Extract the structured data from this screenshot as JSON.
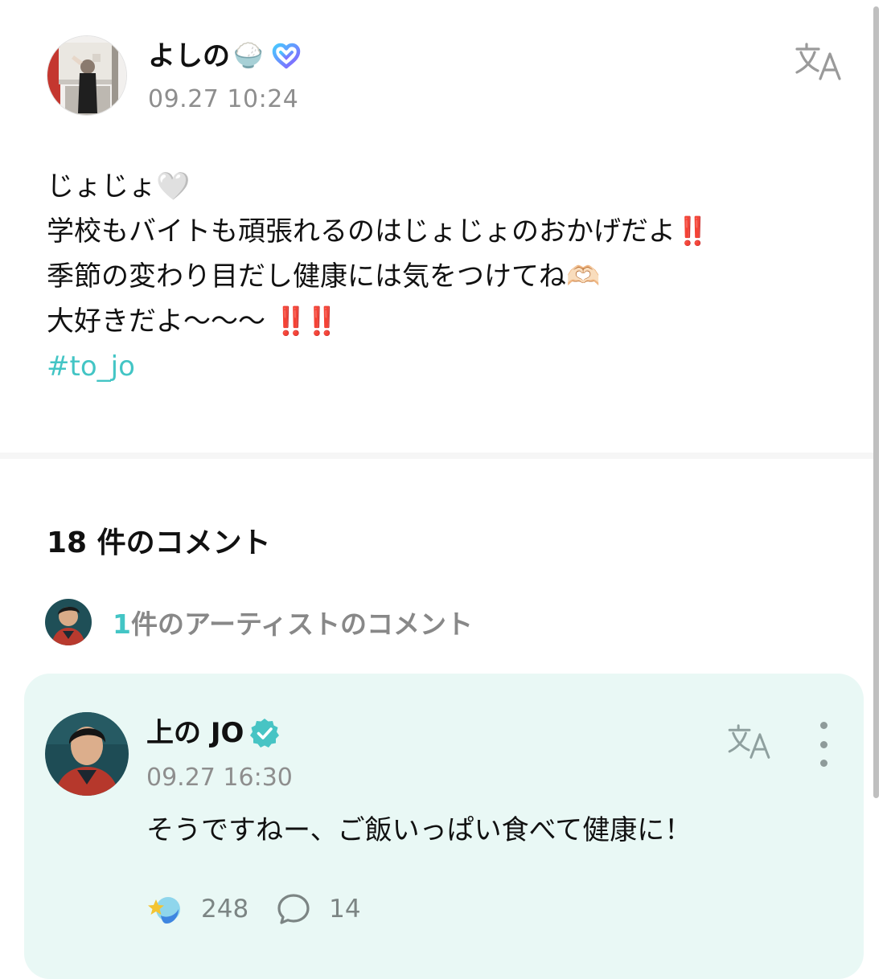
{
  "post": {
    "author_name": "よしの",
    "author_emoji": "🍚",
    "timestamp": "09.27 10:24",
    "lines": [
      {
        "text": "じょじょ",
        "emoji": "🤍"
      },
      {
        "text": "学校もバイトも頑張れるのはじょじょのおかげだよ",
        "emoji": "‼️"
      },
      {
        "text": "季節の変わり目だし健康には気をつけてね",
        "emoji": "🫶🏻"
      },
      {
        "text": "大好きだよ〜〜〜 ",
        "emoji": "‼️‼️"
      }
    ],
    "hashtag": "#to_jo"
  },
  "comments": {
    "count_label": "18 件のコメント",
    "artist_row": {
      "count": "1",
      "label": "件のアーティストのコメント"
    },
    "artist_comment": {
      "name": "上の JO",
      "timestamp": "09.27 16:30",
      "text": "そうですねー、ご飯いっぱい食べて健康に！",
      "likes": "248",
      "replies": "14"
    }
  },
  "colors": {
    "accent": "#43c5c5",
    "card_bg": "#e9f8f5",
    "meta_gray": "#8e8e8e",
    "exclamation_red": "#d9342b"
  },
  "icons": {
    "translate": "translate-icon",
    "membership_badge": "heart-membership-badge-icon",
    "verified": "verified-badge-icon",
    "more": "more-vertical-icon",
    "like": "like-reaction-icon",
    "reply": "comment-bubble-icon"
  }
}
